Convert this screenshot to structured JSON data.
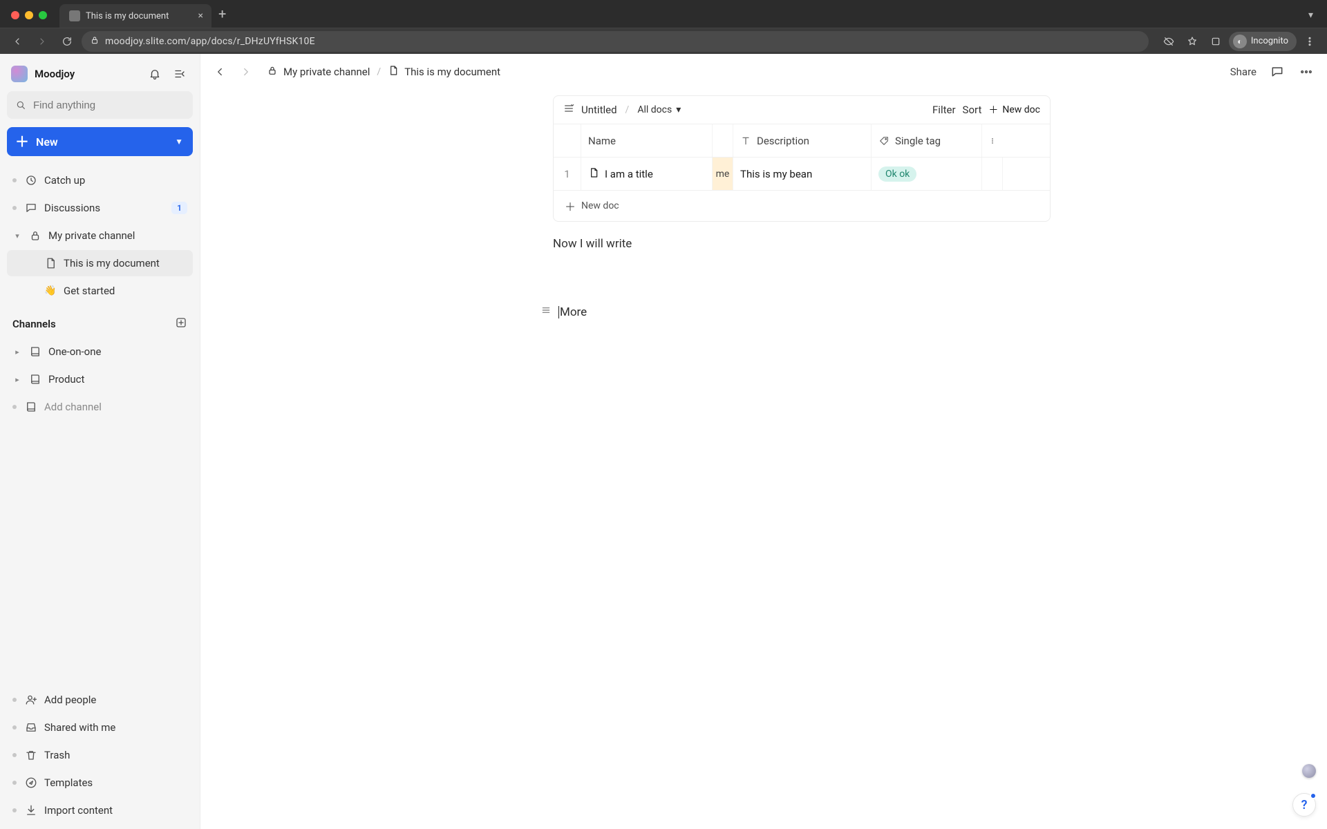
{
  "browser": {
    "tab_title": "This is my document",
    "url": "moodjoy.slite.com/app/docs/r_DHzUYfHSK10E",
    "incognito_label": "Incognito"
  },
  "workspace": {
    "name": "Moodjoy"
  },
  "search": {
    "placeholder": "Find anything"
  },
  "new_button": {
    "label": "New"
  },
  "nav": {
    "catch_up": "Catch up",
    "discussions": "Discussions",
    "discussions_badge": "1"
  },
  "private_channel": {
    "label": "My private channel",
    "docs": [
      {
        "label": "This is my document"
      },
      {
        "label": "Get started",
        "emoji": "👋"
      }
    ]
  },
  "channels_header": "Channels",
  "channels": [
    {
      "label": "One-on-one"
    },
    {
      "label": "Product"
    }
  ],
  "add_channel": "Add channel",
  "footer": {
    "add_people": "Add people",
    "shared": "Shared with me",
    "trash": "Trash",
    "templates": "Templates",
    "import": "Import content"
  },
  "breadcrumb": {
    "parent": "My private channel",
    "current": "This is my document"
  },
  "topbar": {
    "share": "Share"
  },
  "table": {
    "view_title": "Untitled",
    "all_docs": "All docs",
    "filter": "Filter",
    "sort": "Sort",
    "new_doc": "New doc",
    "columns": {
      "name": "Name",
      "description": "Description",
      "single_tag": "Single tag"
    },
    "rows": [
      {
        "index": "1",
        "name": "I am a title",
        "extra": "me",
        "description": "This is my bean",
        "tag": "Ok ok"
      }
    ],
    "new_row": "New doc"
  },
  "body": {
    "line1": "Now I will write",
    "more": "More"
  }
}
